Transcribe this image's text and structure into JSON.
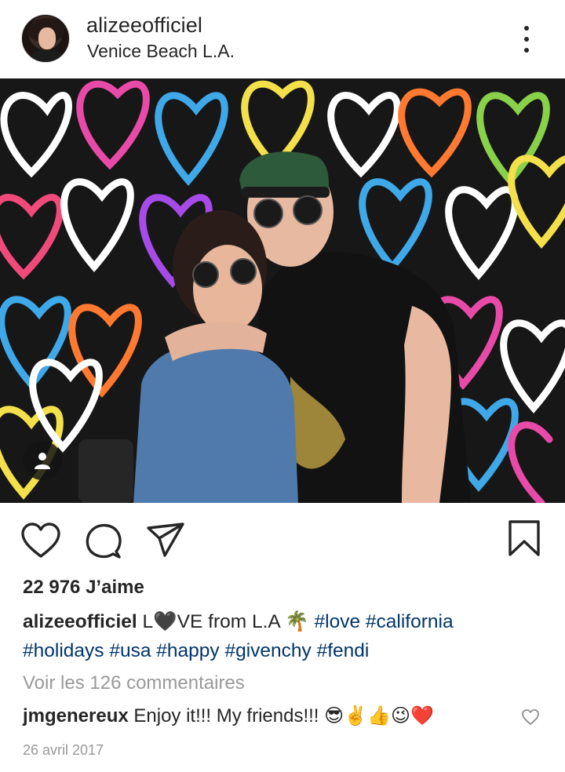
{
  "post": {
    "username": "alizeeofficiel",
    "location": "Venice Beach L.A.",
    "likes": "22 976 J’aime",
    "caption": {
      "user": "alizeeofficiel",
      "text_a": " L",
      "heart": "🖤",
      "text_b": "VE from L.A ",
      "palm": "🌴",
      "hashtags_line1": [
        "#love",
        "#california"
      ],
      "hashtags_line2": [
        "#holidays",
        "#usa",
        "#happy",
        "#givenchy",
        "#fendi"
      ]
    },
    "view_comments": "Voir les 126 commentaires",
    "comment": {
      "user": "jmgenereux",
      "text": " Enjoy it!!! My friends!!! ",
      "emojis": [
        "😎",
        "✌️",
        "👍",
        "😉",
        "❤️"
      ]
    },
    "date": "26 avril 2017"
  },
  "icons": {
    "more": "more-options-icon",
    "like": "heart-icon",
    "comment": "comment-bubble-icon",
    "share": "send-icon",
    "save": "bookmark-icon",
    "tag": "user-tag-icon"
  },
  "colors": {
    "text": "#262626",
    "hashtag": "#003569",
    "muted": "#999999"
  }
}
